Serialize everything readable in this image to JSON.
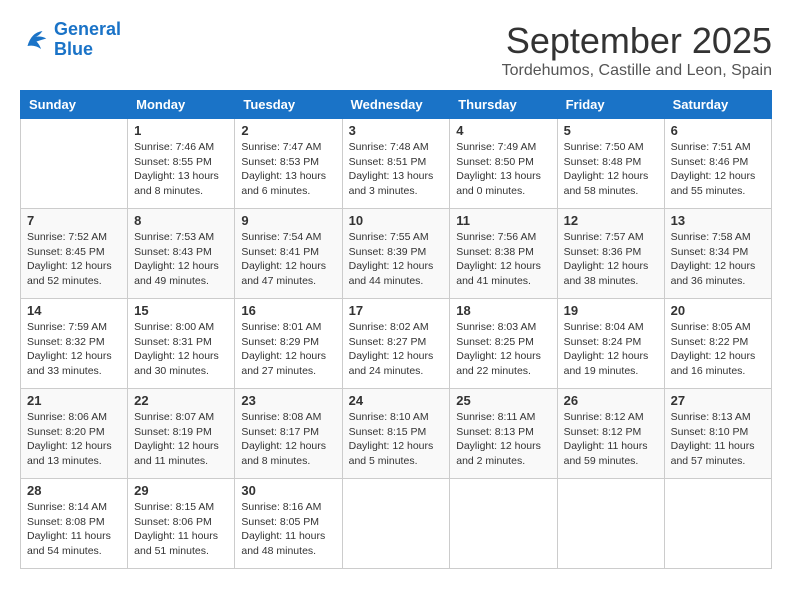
{
  "header": {
    "logo_line1": "General",
    "logo_line2": "Blue",
    "month": "September 2025",
    "location": "Tordehumos, Castille and Leon, Spain"
  },
  "weekdays": [
    "Sunday",
    "Monday",
    "Tuesday",
    "Wednesday",
    "Thursday",
    "Friday",
    "Saturday"
  ],
  "weeks": [
    [
      {
        "day": "",
        "info": ""
      },
      {
        "day": "1",
        "info": "Sunrise: 7:46 AM\nSunset: 8:55 PM\nDaylight: 13 hours\nand 8 minutes."
      },
      {
        "day": "2",
        "info": "Sunrise: 7:47 AM\nSunset: 8:53 PM\nDaylight: 13 hours\nand 6 minutes."
      },
      {
        "day": "3",
        "info": "Sunrise: 7:48 AM\nSunset: 8:51 PM\nDaylight: 13 hours\nand 3 minutes."
      },
      {
        "day": "4",
        "info": "Sunrise: 7:49 AM\nSunset: 8:50 PM\nDaylight: 13 hours\nand 0 minutes."
      },
      {
        "day": "5",
        "info": "Sunrise: 7:50 AM\nSunset: 8:48 PM\nDaylight: 12 hours\nand 58 minutes."
      },
      {
        "day": "6",
        "info": "Sunrise: 7:51 AM\nSunset: 8:46 PM\nDaylight: 12 hours\nand 55 minutes."
      }
    ],
    [
      {
        "day": "7",
        "info": "Sunrise: 7:52 AM\nSunset: 8:45 PM\nDaylight: 12 hours\nand 52 minutes."
      },
      {
        "day": "8",
        "info": "Sunrise: 7:53 AM\nSunset: 8:43 PM\nDaylight: 12 hours\nand 49 minutes."
      },
      {
        "day": "9",
        "info": "Sunrise: 7:54 AM\nSunset: 8:41 PM\nDaylight: 12 hours\nand 47 minutes."
      },
      {
        "day": "10",
        "info": "Sunrise: 7:55 AM\nSunset: 8:39 PM\nDaylight: 12 hours\nand 44 minutes."
      },
      {
        "day": "11",
        "info": "Sunrise: 7:56 AM\nSunset: 8:38 PM\nDaylight: 12 hours\nand 41 minutes."
      },
      {
        "day": "12",
        "info": "Sunrise: 7:57 AM\nSunset: 8:36 PM\nDaylight: 12 hours\nand 38 minutes."
      },
      {
        "day": "13",
        "info": "Sunrise: 7:58 AM\nSunset: 8:34 PM\nDaylight: 12 hours\nand 36 minutes."
      }
    ],
    [
      {
        "day": "14",
        "info": "Sunrise: 7:59 AM\nSunset: 8:32 PM\nDaylight: 12 hours\nand 33 minutes."
      },
      {
        "day": "15",
        "info": "Sunrise: 8:00 AM\nSunset: 8:31 PM\nDaylight: 12 hours\nand 30 minutes."
      },
      {
        "day": "16",
        "info": "Sunrise: 8:01 AM\nSunset: 8:29 PM\nDaylight: 12 hours\nand 27 minutes."
      },
      {
        "day": "17",
        "info": "Sunrise: 8:02 AM\nSunset: 8:27 PM\nDaylight: 12 hours\nand 24 minutes."
      },
      {
        "day": "18",
        "info": "Sunrise: 8:03 AM\nSunset: 8:25 PM\nDaylight: 12 hours\nand 22 minutes."
      },
      {
        "day": "19",
        "info": "Sunrise: 8:04 AM\nSunset: 8:24 PM\nDaylight: 12 hours\nand 19 minutes."
      },
      {
        "day": "20",
        "info": "Sunrise: 8:05 AM\nSunset: 8:22 PM\nDaylight: 12 hours\nand 16 minutes."
      }
    ],
    [
      {
        "day": "21",
        "info": "Sunrise: 8:06 AM\nSunset: 8:20 PM\nDaylight: 12 hours\nand 13 minutes."
      },
      {
        "day": "22",
        "info": "Sunrise: 8:07 AM\nSunset: 8:19 PM\nDaylight: 12 hours\nand 11 minutes."
      },
      {
        "day": "23",
        "info": "Sunrise: 8:08 AM\nSunset: 8:17 PM\nDaylight: 12 hours\nand 8 minutes."
      },
      {
        "day": "24",
        "info": "Sunrise: 8:10 AM\nSunset: 8:15 PM\nDaylight: 12 hours\nand 5 minutes."
      },
      {
        "day": "25",
        "info": "Sunrise: 8:11 AM\nSunset: 8:13 PM\nDaylight: 12 hours\nand 2 minutes."
      },
      {
        "day": "26",
        "info": "Sunrise: 8:12 AM\nSunset: 8:12 PM\nDaylight: 11 hours\nand 59 minutes."
      },
      {
        "day": "27",
        "info": "Sunrise: 8:13 AM\nSunset: 8:10 PM\nDaylight: 11 hours\nand 57 minutes."
      }
    ],
    [
      {
        "day": "28",
        "info": "Sunrise: 8:14 AM\nSunset: 8:08 PM\nDaylight: 11 hours\nand 54 minutes."
      },
      {
        "day": "29",
        "info": "Sunrise: 8:15 AM\nSunset: 8:06 PM\nDaylight: 11 hours\nand 51 minutes."
      },
      {
        "day": "30",
        "info": "Sunrise: 8:16 AM\nSunset: 8:05 PM\nDaylight: 11 hours\nand 48 minutes."
      },
      {
        "day": "",
        "info": ""
      },
      {
        "day": "",
        "info": ""
      },
      {
        "day": "",
        "info": ""
      },
      {
        "day": "",
        "info": ""
      }
    ]
  ]
}
